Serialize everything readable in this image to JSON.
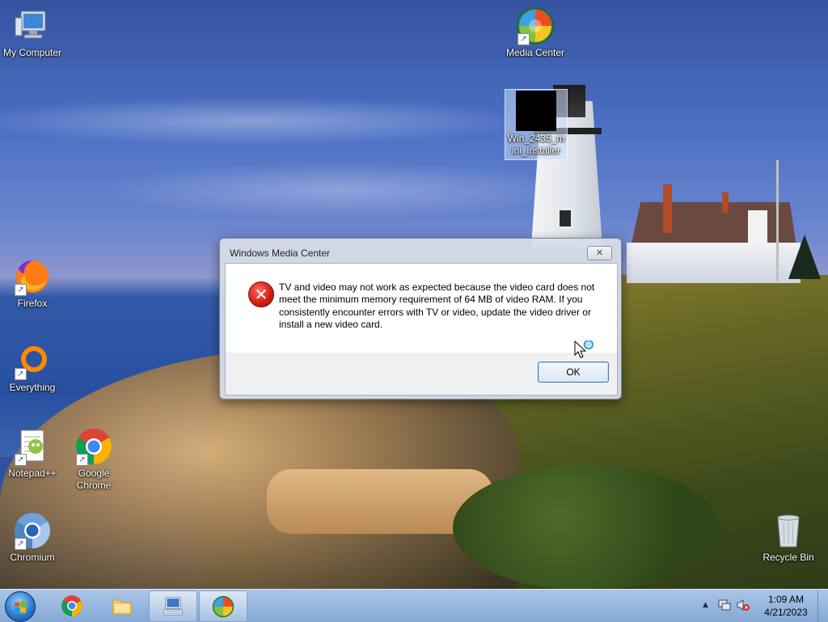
{
  "desktop": {
    "icons": {
      "my_computer": "My Computer",
      "media_center": "Media Center",
      "installer": "Win_2435_mini_installer",
      "firefox": "Firefox",
      "everything": "Everything",
      "notepadpp": "Notepad++",
      "chrome": "Google Chrome",
      "chromium": "Chromium",
      "recycle_bin": "Recycle Bin"
    }
  },
  "dialog": {
    "title": "Windows Media Center",
    "close_label": "✕",
    "message": "TV and video may not work as expected because the video card does not meet the minimum memory requirement of 64 MB of video RAM. If you consistently encounter errors with TV or video, update the video driver or install a new video card.",
    "ok_label": "OK",
    "icon": "error-icon"
  },
  "taskbar": {
    "pinned": [
      "chrome-icon",
      "file-explorer-icon",
      "keyboard-app-icon",
      "media-center-icon"
    ],
    "active": "media-center-icon",
    "tray": {
      "arrow": "▲",
      "time": "1:09 AM",
      "date": "4/21/2023"
    }
  },
  "colors": {
    "accent": "#2d7bd0",
    "error": "#d01c12"
  }
}
